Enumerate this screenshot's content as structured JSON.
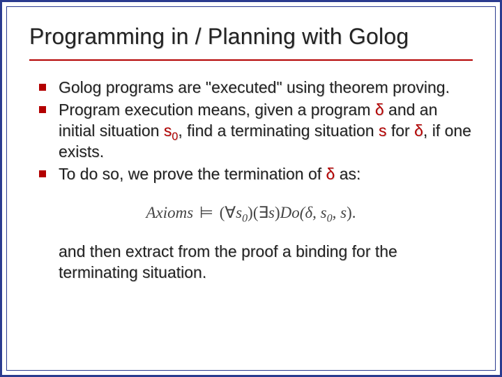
{
  "title": "Programming in / Planning with Golog",
  "bullets": [
    {
      "pre": "Golog programs are \"executed\" using theorem proving.",
      "var1": "",
      "mid1": "",
      "var2": "",
      "mid2": "",
      "var3": "",
      "mid3": "",
      "var4": "",
      "post": ""
    },
    {
      "pre": "Program execution means, given a program ",
      "var1": "δ",
      "mid1": " and an initial situation ",
      "var2": "s",
      "sub2": "0",
      "mid2": ", find a terminating situation ",
      "var3": "s",
      "mid3": " for ",
      "var4": "δ",
      "post": ", if one exists."
    },
    {
      "pre": "To do so, we prove the termination of ",
      "var1": "δ",
      "mid1": " as:",
      "var2": "",
      "mid2": "",
      "var3": "",
      "mid3": "",
      "var4": "",
      "post": ""
    }
  ],
  "formula": {
    "axioms": "Axioms",
    "models": "⊨",
    "forall": "(∀",
    "s0": "s",
    "s0sub": "0",
    "close1": ")",
    "exists": "(∃",
    "s": "s",
    "close2": ")",
    "do": "Do(",
    "delta": "δ",
    "comma1": ", ",
    "arg2": "s",
    "arg2sub": "0",
    "comma2": ", ",
    "arg3": "s",
    "close3": ").",
    "space": " "
  },
  "followup": "and then extract from the proof a binding for the terminating situation."
}
